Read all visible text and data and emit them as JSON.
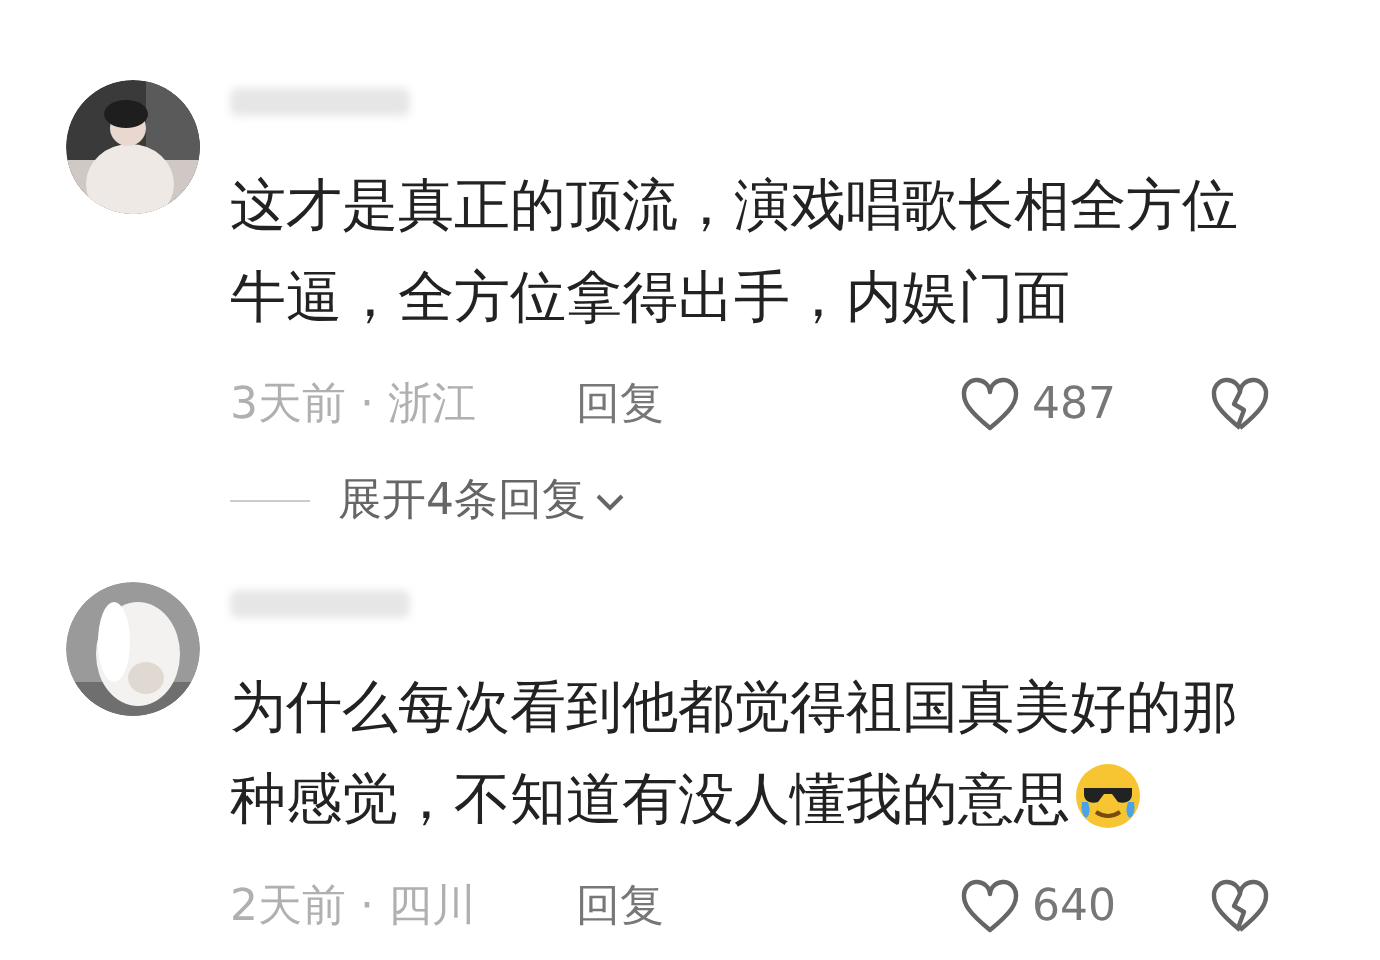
{
  "comments": [
    {
      "text": "这才是真正的顶流，演戏唱歌长相全方位牛逼，全方位拿得出手，内娱门面",
      "emoji": false,
      "meta": "3天前 · 浙江",
      "reply": "回复",
      "likes": "487",
      "expand": "展开4条回复"
    },
    {
      "text": "为什么每次看到他都觉得祖国真美好的那种感觉，不知道有没人懂我的意思",
      "emoji": true,
      "meta": "2天前 · 四川",
      "reply": "回复",
      "likes": "640"
    }
  ]
}
